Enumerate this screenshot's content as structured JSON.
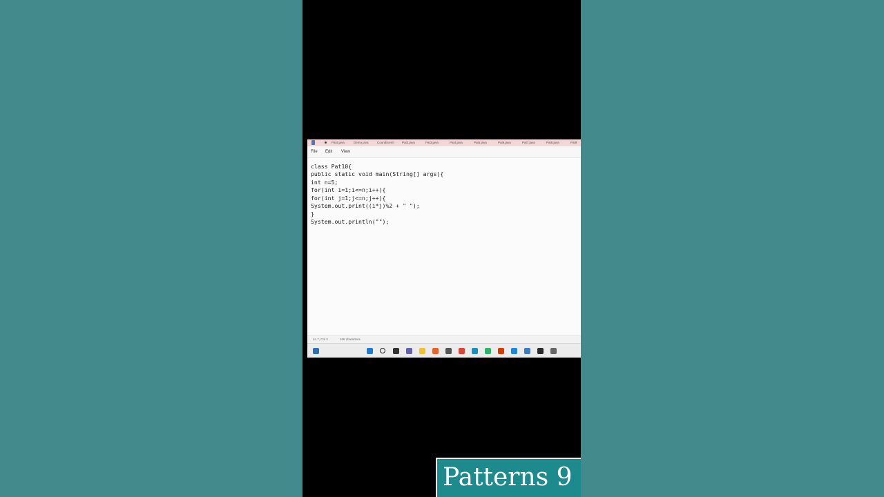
{
  "editor_tabs": [
    "Pat4.java",
    "Demo.java",
    "CountEven0",
    "Pat2.java",
    "Pat3.java",
    "Pat4.java",
    "Pat5.java",
    "Pat6.java",
    "Pat7.java",
    "Pat8.java",
    "Pat9"
  ],
  "menu": {
    "file": "File",
    "edit": "Edit",
    "view": "View"
  },
  "code_lines": [
    "class Pat10{",
    "public static void main(String[] args){",
    "int n=5;",
    "for(int i=1;i<=n;i++){",
    "for(int j=1;j<=n;j++){",
    "System.out.print((i*j)%2 + \" \");",
    "}",
    "System.out.println(\"\");"
  ],
  "status": {
    "position": "Ln 7, Col 2",
    "characters": "166 characters"
  },
  "taskbar_icons": [
    {
      "name": "widgets-icon",
      "color": "#2f6fb5"
    },
    {
      "name": "start-icon",
      "color": "#1f7ad1"
    },
    {
      "name": "search-icon",
      "color": "#222222"
    },
    {
      "name": "task-view-icon",
      "color": "#333333"
    },
    {
      "name": "teams-icon",
      "color": "#6264a7"
    },
    {
      "name": "file-explorer-icon",
      "color": "#f2c12e"
    },
    {
      "name": "firefox-icon",
      "color": "#e8622c"
    },
    {
      "name": "camera-icon",
      "color": "#555555"
    },
    {
      "name": "chrome-icon",
      "color": "#db4437"
    },
    {
      "name": "edge-icon",
      "color": "#1b8fbd"
    },
    {
      "name": "edge-dev-icon",
      "color": "#2fb36b"
    },
    {
      "name": "office-icon",
      "color": "#d83b01"
    },
    {
      "name": "vscode-icon",
      "color": "#1f88d8"
    },
    {
      "name": "notepad-icon",
      "color": "#3b7cc7"
    },
    {
      "name": "terminal-icon",
      "color": "#2b2b2b"
    },
    {
      "name": "git-icon",
      "color": "#666666"
    }
  ],
  "caption": "Patterns 9",
  "colors": {
    "background": "#438a8d",
    "caption_bg": "#1d8a8d"
  }
}
